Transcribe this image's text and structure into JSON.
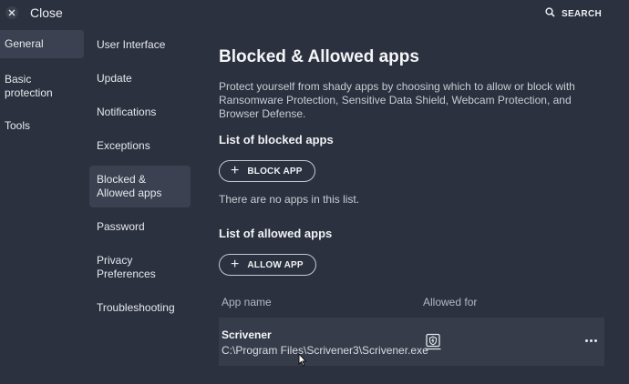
{
  "topbar": {
    "close_label": "Close",
    "search_label": "SEARCH"
  },
  "nav_primary": [
    {
      "label": "General",
      "active": true
    },
    {
      "label": "Basic protection"
    },
    {
      "label": "Tools"
    }
  ],
  "nav_secondary": [
    {
      "label": "User Interface"
    },
    {
      "label": "Update"
    },
    {
      "label": "Notifications"
    },
    {
      "label": "Exceptions"
    },
    {
      "label": "Blocked & Allowed apps",
      "active": true
    },
    {
      "label": "Password"
    },
    {
      "label": "Privacy Preferences"
    },
    {
      "label": "Troubleshooting"
    }
  ],
  "main": {
    "title": "Blocked & Allowed apps",
    "description": "Protect yourself from shady apps by choosing which to allow or block with Ransomware Protection, Sensitive Data Shield, Webcam Protection, and Browser Defense.",
    "blocked": {
      "heading": "List of blocked apps",
      "button_label": "BLOCK APP",
      "empty_text": "There are no apps in this list."
    },
    "allowed": {
      "heading": "List of allowed apps",
      "button_label": "ALLOW APP",
      "columns": [
        "App name",
        "Allowed for"
      ],
      "rows": [
        {
          "name": "Scrivener",
          "path": "C:\\Program Files\\Scrivener3\\Scrivener.exe",
          "allowed_for_icon": "ransomware-shield-icon"
        }
      ]
    }
  },
  "colors": {
    "background": "#2b313f",
    "active_item": "#3b4150",
    "row_background": "#363c4a"
  }
}
